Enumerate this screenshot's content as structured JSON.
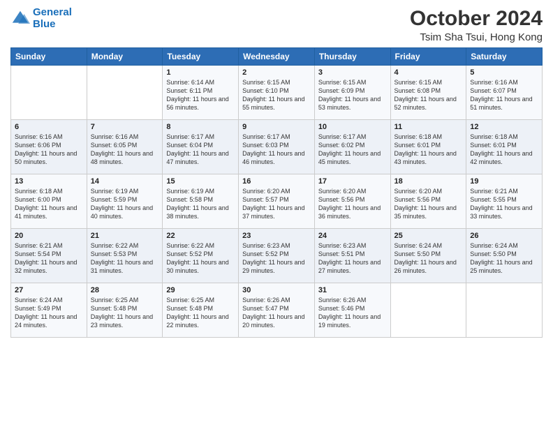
{
  "logo": {
    "line1": "General",
    "line2": "Blue"
  },
  "title": "October 2024",
  "location": "Tsim Sha Tsui, Hong Kong",
  "weekdays": [
    "Sunday",
    "Monday",
    "Tuesday",
    "Wednesday",
    "Thursday",
    "Friday",
    "Saturday"
  ],
  "weeks": [
    [
      {
        "day": "",
        "sunrise": "",
        "sunset": "",
        "daylight": ""
      },
      {
        "day": "",
        "sunrise": "",
        "sunset": "",
        "daylight": ""
      },
      {
        "day": "1",
        "sunrise": "Sunrise: 6:14 AM",
        "sunset": "Sunset: 6:11 PM",
        "daylight": "Daylight: 11 hours and 56 minutes."
      },
      {
        "day": "2",
        "sunrise": "Sunrise: 6:15 AM",
        "sunset": "Sunset: 6:10 PM",
        "daylight": "Daylight: 11 hours and 55 minutes."
      },
      {
        "day": "3",
        "sunrise": "Sunrise: 6:15 AM",
        "sunset": "Sunset: 6:09 PM",
        "daylight": "Daylight: 11 hours and 53 minutes."
      },
      {
        "day": "4",
        "sunrise": "Sunrise: 6:15 AM",
        "sunset": "Sunset: 6:08 PM",
        "daylight": "Daylight: 11 hours and 52 minutes."
      },
      {
        "day": "5",
        "sunrise": "Sunrise: 6:16 AM",
        "sunset": "Sunset: 6:07 PM",
        "daylight": "Daylight: 11 hours and 51 minutes."
      }
    ],
    [
      {
        "day": "6",
        "sunrise": "Sunrise: 6:16 AM",
        "sunset": "Sunset: 6:06 PM",
        "daylight": "Daylight: 11 hours and 50 minutes."
      },
      {
        "day": "7",
        "sunrise": "Sunrise: 6:16 AM",
        "sunset": "Sunset: 6:05 PM",
        "daylight": "Daylight: 11 hours and 48 minutes."
      },
      {
        "day": "8",
        "sunrise": "Sunrise: 6:17 AM",
        "sunset": "Sunset: 6:04 PM",
        "daylight": "Daylight: 11 hours and 47 minutes."
      },
      {
        "day": "9",
        "sunrise": "Sunrise: 6:17 AM",
        "sunset": "Sunset: 6:03 PM",
        "daylight": "Daylight: 11 hours and 46 minutes."
      },
      {
        "day": "10",
        "sunrise": "Sunrise: 6:17 AM",
        "sunset": "Sunset: 6:02 PM",
        "daylight": "Daylight: 11 hours and 45 minutes."
      },
      {
        "day": "11",
        "sunrise": "Sunrise: 6:18 AM",
        "sunset": "Sunset: 6:01 PM",
        "daylight": "Daylight: 11 hours and 43 minutes."
      },
      {
        "day": "12",
        "sunrise": "Sunrise: 6:18 AM",
        "sunset": "Sunset: 6:01 PM",
        "daylight": "Daylight: 11 hours and 42 minutes."
      }
    ],
    [
      {
        "day": "13",
        "sunrise": "Sunrise: 6:18 AM",
        "sunset": "Sunset: 6:00 PM",
        "daylight": "Daylight: 11 hours and 41 minutes."
      },
      {
        "day": "14",
        "sunrise": "Sunrise: 6:19 AM",
        "sunset": "Sunset: 5:59 PM",
        "daylight": "Daylight: 11 hours and 40 minutes."
      },
      {
        "day": "15",
        "sunrise": "Sunrise: 6:19 AM",
        "sunset": "Sunset: 5:58 PM",
        "daylight": "Daylight: 11 hours and 38 minutes."
      },
      {
        "day": "16",
        "sunrise": "Sunrise: 6:20 AM",
        "sunset": "Sunset: 5:57 PM",
        "daylight": "Daylight: 11 hours and 37 minutes."
      },
      {
        "day": "17",
        "sunrise": "Sunrise: 6:20 AM",
        "sunset": "Sunset: 5:56 PM",
        "daylight": "Daylight: 11 hours and 36 minutes."
      },
      {
        "day": "18",
        "sunrise": "Sunrise: 6:20 AM",
        "sunset": "Sunset: 5:56 PM",
        "daylight": "Daylight: 11 hours and 35 minutes."
      },
      {
        "day": "19",
        "sunrise": "Sunrise: 6:21 AM",
        "sunset": "Sunset: 5:55 PM",
        "daylight": "Daylight: 11 hours and 33 minutes."
      }
    ],
    [
      {
        "day": "20",
        "sunrise": "Sunrise: 6:21 AM",
        "sunset": "Sunset: 5:54 PM",
        "daylight": "Daylight: 11 hours and 32 minutes."
      },
      {
        "day": "21",
        "sunrise": "Sunrise: 6:22 AM",
        "sunset": "Sunset: 5:53 PM",
        "daylight": "Daylight: 11 hours and 31 minutes."
      },
      {
        "day": "22",
        "sunrise": "Sunrise: 6:22 AM",
        "sunset": "Sunset: 5:52 PM",
        "daylight": "Daylight: 11 hours and 30 minutes."
      },
      {
        "day": "23",
        "sunrise": "Sunrise: 6:23 AM",
        "sunset": "Sunset: 5:52 PM",
        "daylight": "Daylight: 11 hours and 29 minutes."
      },
      {
        "day": "24",
        "sunrise": "Sunrise: 6:23 AM",
        "sunset": "Sunset: 5:51 PM",
        "daylight": "Daylight: 11 hours and 27 minutes."
      },
      {
        "day": "25",
        "sunrise": "Sunrise: 6:24 AM",
        "sunset": "Sunset: 5:50 PM",
        "daylight": "Daylight: 11 hours and 26 minutes."
      },
      {
        "day": "26",
        "sunrise": "Sunrise: 6:24 AM",
        "sunset": "Sunset: 5:50 PM",
        "daylight": "Daylight: 11 hours and 25 minutes."
      }
    ],
    [
      {
        "day": "27",
        "sunrise": "Sunrise: 6:24 AM",
        "sunset": "Sunset: 5:49 PM",
        "daylight": "Daylight: 11 hours and 24 minutes."
      },
      {
        "day": "28",
        "sunrise": "Sunrise: 6:25 AM",
        "sunset": "Sunset: 5:48 PM",
        "daylight": "Daylight: 11 hours and 23 minutes."
      },
      {
        "day": "29",
        "sunrise": "Sunrise: 6:25 AM",
        "sunset": "Sunset: 5:48 PM",
        "daylight": "Daylight: 11 hours and 22 minutes."
      },
      {
        "day": "30",
        "sunrise": "Sunrise: 6:26 AM",
        "sunset": "Sunset: 5:47 PM",
        "daylight": "Daylight: 11 hours and 20 minutes."
      },
      {
        "day": "31",
        "sunrise": "Sunrise: 6:26 AM",
        "sunset": "Sunset: 5:46 PM",
        "daylight": "Daylight: 11 hours and 19 minutes."
      },
      {
        "day": "",
        "sunrise": "",
        "sunset": "",
        "daylight": ""
      },
      {
        "day": "",
        "sunrise": "",
        "sunset": "",
        "daylight": ""
      }
    ]
  ]
}
